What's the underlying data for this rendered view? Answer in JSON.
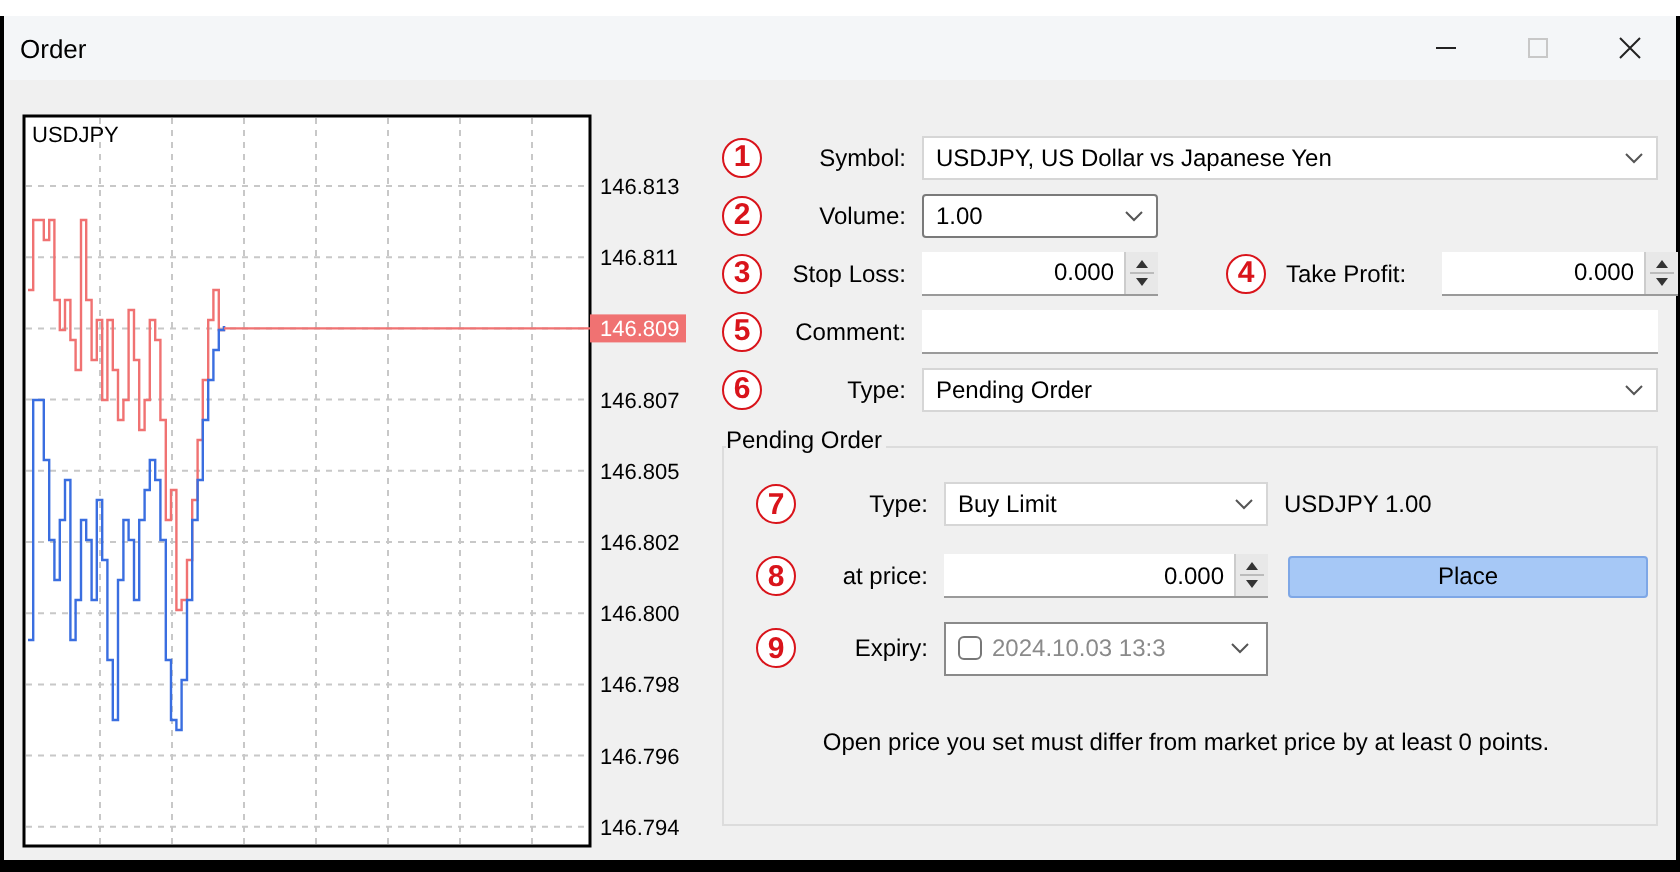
{
  "window": {
    "title": "Order",
    "controls": [
      {
        "kind": "minimize",
        "disabled": false
      },
      {
        "kind": "maximize",
        "disabled": true
      },
      {
        "kind": "close",
        "disabled": false
      }
    ]
  },
  "chart": {
    "symbol": "USDJPY",
    "price_axis": [
      {
        "label": "146.813",
        "current": false
      },
      {
        "label": "146.811",
        "current": false
      },
      {
        "label": "146.809",
        "current": true
      },
      {
        "label": "146.807",
        "current": false
      },
      {
        "label": "146.805",
        "current": false
      },
      {
        "label": "146.802",
        "current": false
      },
      {
        "label": "146.800",
        "current": false
      },
      {
        "label": "146.798",
        "current": false
      },
      {
        "label": "146.796",
        "current": false
      },
      {
        "label": "146.794",
        "current": false
      }
    ]
  },
  "form": {
    "rows": [
      {
        "marker": "1",
        "label": "Symbol:",
        "kind": "select-wide",
        "value": "USDJPY, US Dollar vs Japanese Yen"
      },
      {
        "marker": "2",
        "label": "Volume:",
        "kind": "select",
        "value": "1.00"
      },
      {
        "marker": "3",
        "label": "Stop Loss:",
        "kind": "spin",
        "value": "0.000",
        "pair": {
          "marker": "4",
          "label": "Take Profit:",
          "value": "0.000"
        }
      },
      {
        "marker": "5",
        "label": "Comment:",
        "kind": "text"
      },
      {
        "marker": "6",
        "label": "Type:",
        "kind": "select-wide",
        "value": "Pending Order"
      }
    ]
  },
  "pending_order": {
    "title": "Pending Order",
    "type": {
      "marker": "7",
      "label": "Type:",
      "value": "Buy Limit",
      "info": "USDJPY 1.00"
    },
    "price": {
      "marker": "8",
      "label": "at price:",
      "value": "0.000",
      "button": "Place"
    },
    "expiry": {
      "marker": "9",
      "label": "Expiry:",
      "checked": false,
      "disabled": true,
      "value": "2024.10.03 13:3"
    },
    "note": "Open price you set must differ from market price by at least 0 points."
  }
}
